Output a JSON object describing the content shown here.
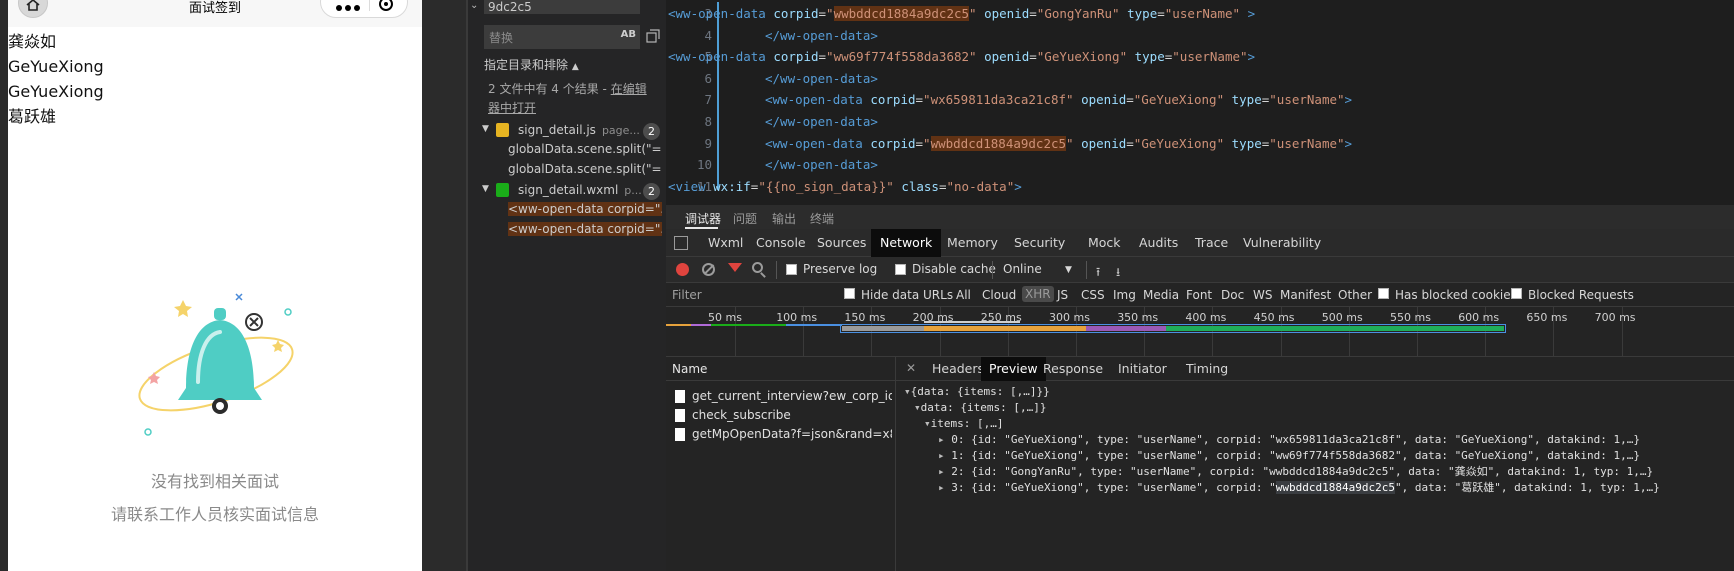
{
  "simulator": {
    "nav_title": "面试签到",
    "names": [
      "龚焱如",
      "GeYueXiong",
      "GeYueXiong",
      "葛跃雄"
    ],
    "empty_title": "没有找到相关面试",
    "empty_subtitle": "请联系工作人员核实面试信息"
  },
  "search": {
    "query": "9dc2c5",
    "replace_placeholder": "替换",
    "case_toggle": "AB",
    "files_toggle": "指定目录和排除",
    "summary_prefix": "2 文件中有 4 个结果 - ",
    "summary_link": "在编辑器中打开",
    "files": [
      {
        "name": "sign_detail.js",
        "path": "page...",
        "count": "2",
        "icon_color": "#e6b422",
        "matches": [
          "globalData.scene.split(\"=\"...",
          "globalData.scene.split(\"=\"..."
        ]
      },
      {
        "name": "sign_detail.wxml",
        "path": "p...",
        "count": "2",
        "icon_color": "#1aad19",
        "matches": [
          "<ww-open-data corpid=\"...",
          "<ww-open-data corpid=\"..."
        ]
      }
    ]
  },
  "editor": {
    "line_numbers": [
      "3",
      "4",
      "5",
      "6",
      "7",
      "8",
      "9",
      "10",
      "11"
    ],
    "lines": [
      {
        "indent": 0,
        "tokens": [
          [
            "tag",
            "<ww-open-data "
          ],
          [
            "attr",
            "corpid"
          ],
          [
            "eq",
            "="
          ],
          [
            "str",
            "\""
          ],
          [
            "strhl",
            "wwbddcd1884a9dc2c5"
          ],
          [
            "str",
            "\""
          ],
          [
            "eq",
            " "
          ],
          [
            "attr",
            "openid"
          ],
          [
            "eq",
            "="
          ],
          [
            "str",
            "\"GongYanRu\""
          ],
          [
            "eq",
            " "
          ],
          [
            "attr",
            "type"
          ],
          [
            "eq",
            "="
          ],
          [
            "str",
            "\"userName\""
          ],
          [
            "eq",
            " "
          ],
          [
            "tag",
            ">"
          ]
        ]
      },
      {
        "indent": 1,
        "tokens": [
          [
            "tag",
            "</ww-open-data>"
          ]
        ]
      },
      {
        "indent": 0,
        "tokens": [
          [
            "tag",
            "<ww-open-data "
          ],
          [
            "attr",
            "corpid"
          ],
          [
            "eq",
            "="
          ],
          [
            "str",
            "\"ww69f774f558da3682\""
          ],
          [
            "eq",
            " "
          ],
          [
            "attr",
            "openid"
          ],
          [
            "eq",
            "="
          ],
          [
            "str",
            "\"GeYueXiong\""
          ],
          [
            "eq",
            " "
          ],
          [
            "attr",
            "type"
          ],
          [
            "eq",
            "="
          ],
          [
            "str",
            "\"userName\""
          ],
          [
            "tag",
            ">"
          ]
        ]
      },
      {
        "indent": 1,
        "tokens": [
          [
            "tag",
            "</ww-open-data>"
          ]
        ]
      },
      {
        "indent": 1,
        "tokens": [
          [
            "tag",
            "<ww-open-data "
          ],
          [
            "attr",
            "corpid"
          ],
          [
            "eq",
            "="
          ],
          [
            "str",
            "\"wx659811da3ca21c8f\""
          ],
          [
            "eq",
            " "
          ],
          [
            "attr",
            "openid"
          ],
          [
            "eq",
            "="
          ],
          [
            "str",
            "\"GeYueXiong\""
          ],
          [
            "eq",
            " "
          ],
          [
            "attr",
            "type"
          ],
          [
            "eq",
            "="
          ],
          [
            "str",
            "\"userName\""
          ],
          [
            "tag",
            ">"
          ]
        ]
      },
      {
        "indent": 1,
        "tokens": [
          [
            "tag",
            "</ww-open-data>"
          ]
        ]
      },
      {
        "indent": 1,
        "tokens": [
          [
            "tag",
            "<ww-open-data "
          ],
          [
            "attr",
            "corpid"
          ],
          [
            "eq",
            "="
          ],
          [
            "str",
            "\""
          ],
          [
            "strhl",
            "wwbddcd1884a9dc2c5"
          ],
          [
            "str",
            "\""
          ],
          [
            "eq",
            " "
          ],
          [
            "attr",
            "openid"
          ],
          [
            "eq",
            "="
          ],
          [
            "str",
            "\"GeYueXiong\""
          ],
          [
            "eq",
            " "
          ],
          [
            "attr",
            "type"
          ],
          [
            "eq",
            "="
          ],
          [
            "str",
            "\"userName\""
          ],
          [
            "tag",
            ">"
          ]
        ]
      },
      {
        "indent": 1,
        "tokens": [
          [
            "tag",
            "</ww-open-data>"
          ]
        ]
      },
      {
        "indent": 0,
        "tokens": [
          [
            "tag",
            "<view "
          ],
          [
            "attr",
            "wx:if"
          ],
          [
            "eq",
            "="
          ],
          [
            "str",
            "\"{{no_sign_data}}\""
          ],
          [
            "eq",
            " "
          ],
          [
            "attr",
            "class"
          ],
          [
            "eq",
            "="
          ],
          [
            "str",
            "\"no-data\""
          ],
          [
            "tag",
            ">"
          ]
        ]
      }
    ]
  },
  "devtools": {
    "top_tabs": [
      "调试器",
      "问题",
      "输出",
      "终端"
    ],
    "panel_tabs": [
      "Wxml",
      "Console",
      "Sources",
      "Network",
      "Memory",
      "Security",
      "Mock",
      "Audits",
      "Trace",
      "Vulnerability"
    ],
    "active_panel": "Network",
    "toolbar": {
      "preserve_log": "Preserve log",
      "disable_cache": "Disable cache",
      "throttle": "Online",
      "caret": "▼"
    },
    "filter": {
      "placeholder": "Filter",
      "hide_data_urls": "Hide data URLs",
      "types": [
        "All",
        "Cloud",
        "XHR",
        "JS",
        "CSS",
        "Img",
        "Media",
        "Font",
        "Doc",
        "WS",
        "Manifest",
        "Other"
      ],
      "selected_type": "XHR",
      "has_blocked_cookies": "Has blocked cookies",
      "blocked_requests": "Blocked Requests"
    },
    "timeline_ticks": [
      "50 ms",
      "100 ms",
      "150 ms",
      "200 ms",
      "250 ms",
      "300 ms",
      "350 ms",
      "400 ms",
      "450 ms",
      "500 ms",
      "550 ms",
      "600 ms",
      "650 ms",
      "700 ms"
    ],
    "name_header": "Name",
    "requests": [
      "get_current_interview?ew_corp_id=wwb...",
      "check_subscribe",
      "getMpOpenData?f=json&rand=x8lgvib1..."
    ],
    "detail_tabs": [
      "Headers",
      "Preview",
      "Response",
      "Initiator",
      "Timing"
    ],
    "active_detail": "Preview",
    "preview": {
      "root": "{data: {items: [,…]}}",
      "data": "data: {items: [,…]}",
      "items": "items: [,…]",
      "rows": [
        "0: {id: \"GeYueXiong\", type: \"userName\", corpid: \"wx659811da3ca21c8f\", data: \"GeYueXiong\", datakind: 1,…}",
        "1: {id: \"GeYueXiong\", type: \"userName\", corpid: \"ww69f774f558da3682\", data: \"GeYueXiong\", datakind: 1,…}",
        "2: {id: \"GongYanRu\", type: \"userName\", corpid: \"wwbddcd1884a9dc2c5\", data: \"龚焱如\", datakind: 1, typ: 1,…}"
      ],
      "row3_prefix": "3: {id: \"GeYueXiong\", type: \"userName\", corpid: \"",
      "row3_highlight": "wwbddcd1884a9dc2c5",
      "row3_suffix": "\", data: \"葛跃雄\", datakind: 1, typ: 1,…}"
    }
  }
}
